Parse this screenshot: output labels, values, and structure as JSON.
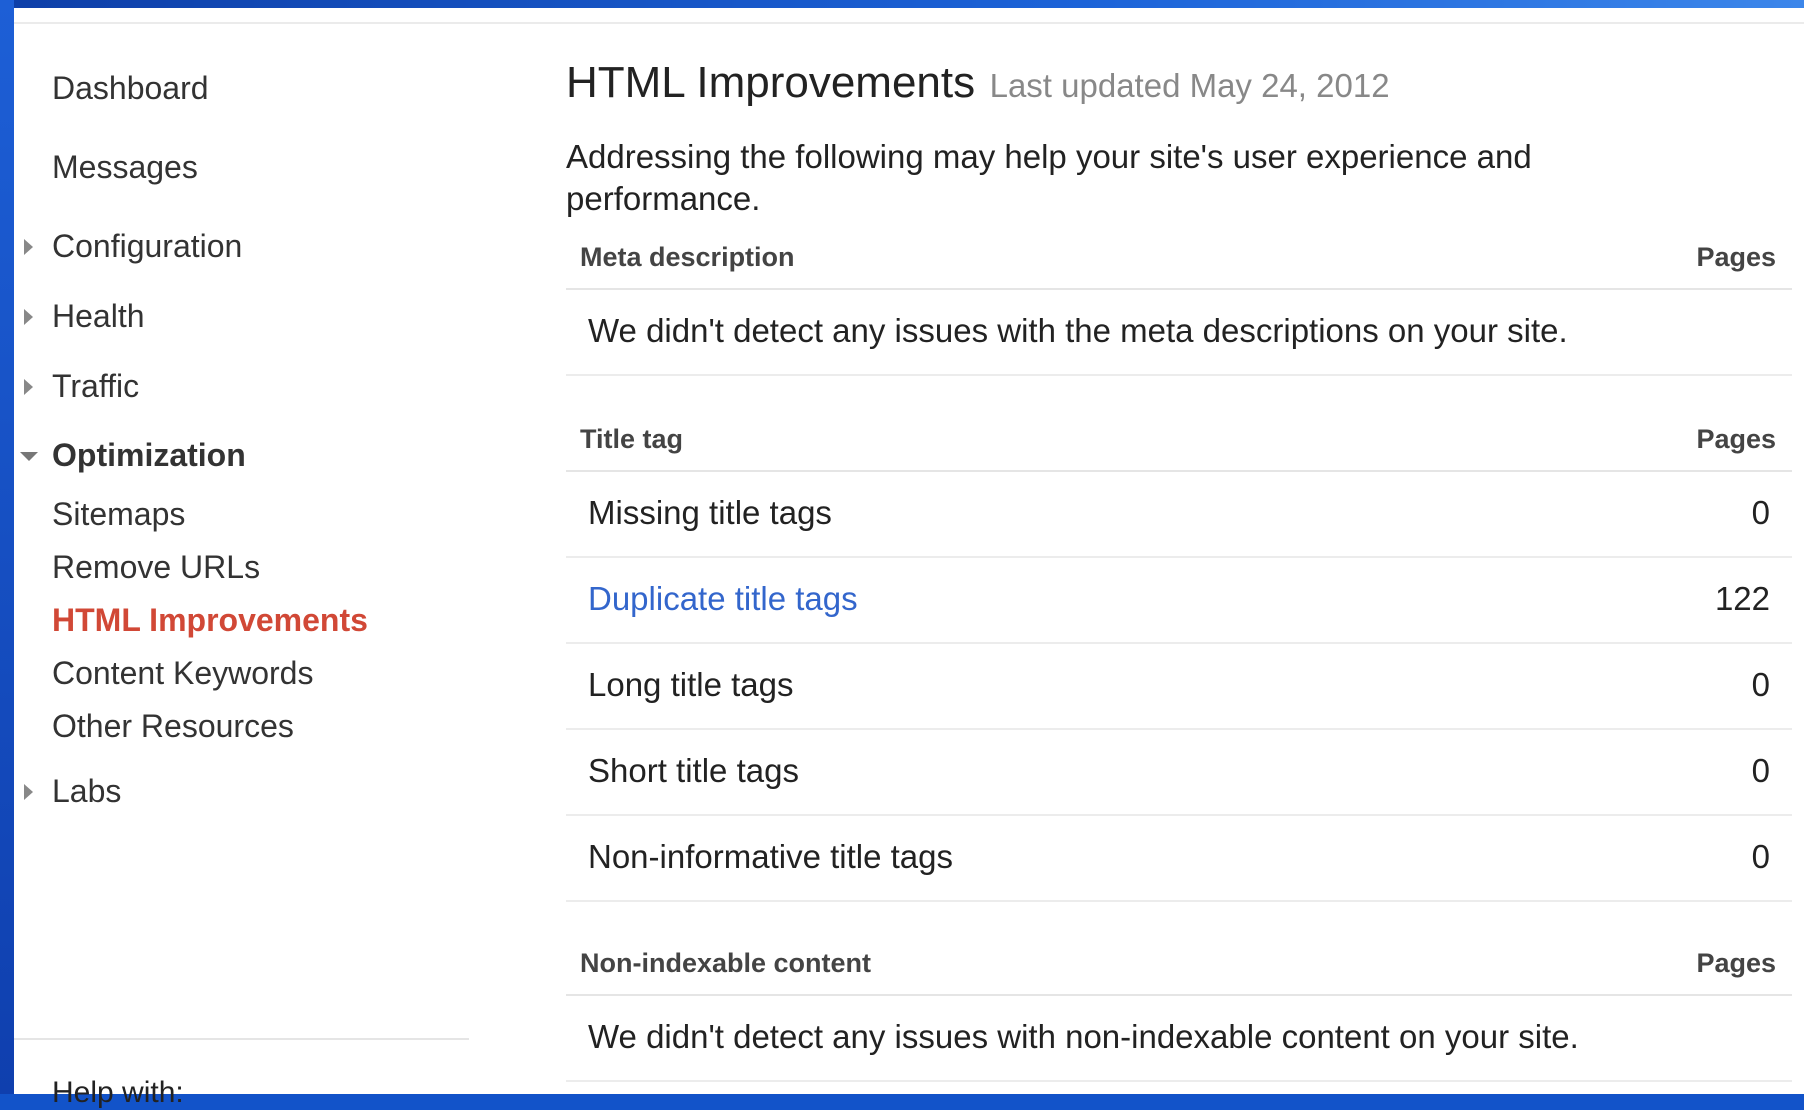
{
  "sidebar": {
    "items": [
      {
        "label": "Dashboard"
      },
      {
        "label": "Messages"
      },
      {
        "label": "Configuration"
      },
      {
        "label": "Health"
      },
      {
        "label": "Traffic"
      },
      {
        "label": "Optimization"
      },
      {
        "label": "Sitemaps"
      },
      {
        "label": "Remove URLs"
      },
      {
        "label": "HTML Improvements"
      },
      {
        "label": "Content Keywords"
      },
      {
        "label": "Other Resources"
      },
      {
        "label": "Labs"
      }
    ],
    "help_label": "Help with:"
  },
  "main": {
    "title": "HTML Improvements",
    "last_updated": "Last updated May 24, 2012",
    "intro": "Addressing the following may help your site's user experience and performance.",
    "sections": {
      "meta": {
        "header": "Meta description",
        "pages_label": "Pages",
        "message": "We didn't detect any issues with the meta descriptions on your site."
      },
      "title": {
        "header": "Title tag",
        "pages_label": "Pages",
        "rows": [
          {
            "label": "Missing title tags",
            "count": "0"
          },
          {
            "label": "Duplicate title tags",
            "count": "122"
          },
          {
            "label": "Long title tags",
            "count": "0"
          },
          {
            "label": "Short title tags",
            "count": "0"
          },
          {
            "label": "Non-informative title tags",
            "count": "0"
          }
        ]
      },
      "nonindexable": {
        "header": "Non-indexable content",
        "pages_label": "Pages",
        "message": "We didn't detect any issues with non-indexable content on your site."
      }
    }
  },
  "colors": {
    "active_nav": "#d14836",
    "link": "#3366cc",
    "frame": "#1253c9"
  }
}
